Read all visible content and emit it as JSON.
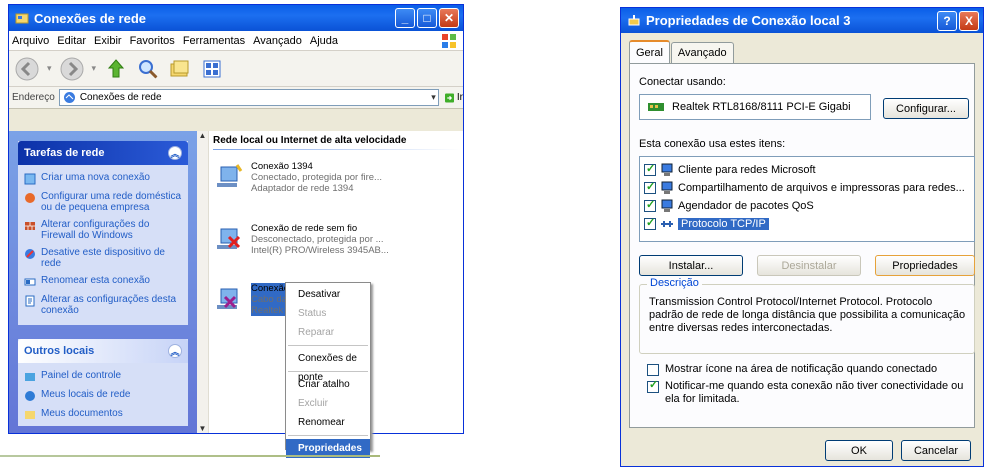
{
  "left_window": {
    "title": "Conexões de rede",
    "menu": [
      "Arquivo",
      "Editar",
      "Exibir",
      "Favoritos",
      "Ferramentas",
      "Avançado",
      "Ajuda"
    ],
    "address_label": "Endereço",
    "address_value": "Conexões de rede",
    "go_label": "Ir",
    "tasks_header": "Tarefas de rede",
    "tasks": [
      "Criar uma nova conexão",
      "Configurar uma rede doméstica ou de pequena empresa",
      "Alterar configurações do Firewall do Windows",
      "Desative este dispositivo de rede",
      "Renomear esta conexão",
      "Alterar as configurações desta conexão"
    ],
    "other_header": "Outros locais",
    "other_places": [
      "Painel de controle",
      "Meus locais de rede",
      "Meus documentos"
    ],
    "section_title": "Rede local ou Internet de alta velocidade",
    "connections": [
      {
        "name": "Conexão 1394",
        "status": "Conectado, protegida por fire...",
        "device": "Adaptador de rede 1394"
      },
      {
        "name": "Conexão de rede sem fio",
        "status": "Desconectado, protegida por ...",
        "device": "Intel(R) PRO/Wireless 3945AB..."
      },
      {
        "name": "Conexão l",
        "status": "Cabo da re",
        "device": "Realtek RT"
      }
    ],
    "context_menu": [
      "Desativar",
      "Status",
      "Reparar",
      "Conexões de ponte",
      "Criar atalho",
      "Excluir",
      "Renomear",
      "Propriedades"
    ]
  },
  "dialog": {
    "title": "Propriedades de Conexão local 3",
    "tabs": [
      "Geral",
      "Avançado"
    ],
    "connect_using_label": "Conectar usando:",
    "device": "Realtek RTL8168/8111 PCI-E Gigabi",
    "configure_button": "Configurar...",
    "items_label": "Esta conexão usa estes itens:",
    "items": [
      {
        "label": "Cliente para redes Microsoft",
        "checked": true,
        "selected": false
      },
      {
        "label": "Compartilhamento de arquivos e impressoras para redes...",
        "checked": true,
        "selected": false
      },
      {
        "label": "Agendador de pacotes QoS",
        "checked": true,
        "selected": false
      },
      {
        "label": "Protocolo TCP/IP",
        "checked": true,
        "selected": true
      }
    ],
    "install_button": "Instalar...",
    "uninstall_button": "Desinstalar",
    "properties_button": "Propriedades",
    "description_label": "Descrição",
    "description_text": "Transmission Control Protocol/Internet Protocol. Protocolo padrão de rede de longa distância que possibilita a comunicação entre diversas redes interconectadas.",
    "show_icon_label": "Mostrar ícone na área de notificação quando conectado",
    "show_icon_checked": false,
    "notify_label": "Notificar-me quando esta conexão não tiver conectividade ou ela for limitada.",
    "notify_checked": true,
    "ok_button": "OK",
    "cancel_button": "Cancelar",
    "help_glyph": "?",
    "close_glyph": "X"
  },
  "colors": {
    "title_blue": "#0a5ee8",
    "selection": "#316ac5",
    "link": "#215dc6"
  }
}
